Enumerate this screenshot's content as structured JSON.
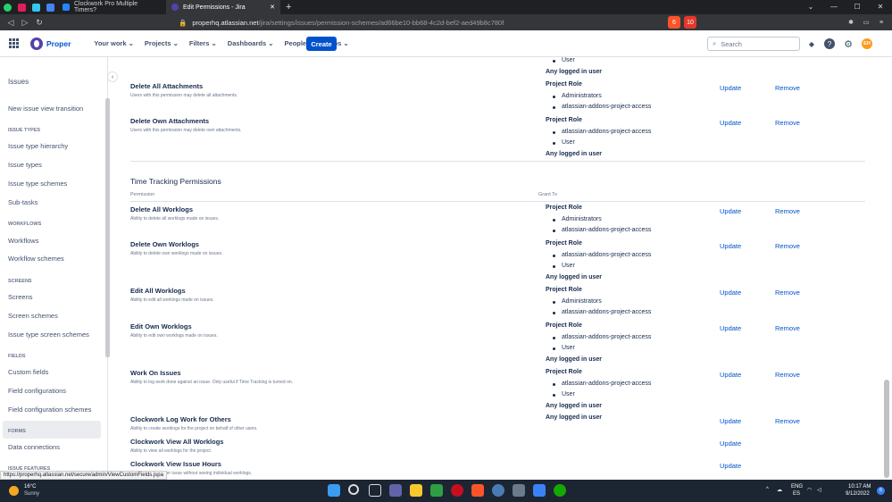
{
  "browser": {
    "tabs": [
      {
        "title": "Clockwork Pro Multiple Timers?",
        "active": false
      },
      {
        "title": "Edit Permissions - Jira",
        "active": true
      }
    ],
    "url_host": "properhq.atlassian.net",
    "url_path": "/jira/settings/issues/permission-schemes/ad66be10-bb68-4c2d-bef2-aed49b8c780f",
    "extension_badge_1": "6",
    "extension_badge_2": "10",
    "status_url": "https://properhq.atlassian.net/secure/admin/ViewCustomFields.jspa"
  },
  "topnav": {
    "logo": "Proper",
    "menus": [
      "Your work",
      "Projects",
      "Filters",
      "Dashboards",
      "People",
      "Apps"
    ],
    "create_label": "Create",
    "search_placeholder": "Search",
    "avatar_initials": "EH"
  },
  "sidebar": {
    "title": "Issues",
    "items": [
      {
        "type": "item",
        "label": "New issue view transition"
      },
      {
        "type": "head",
        "label": "ISSUE TYPES"
      },
      {
        "type": "item",
        "label": "Issue type hierarchy"
      },
      {
        "type": "item",
        "label": "Issue types"
      },
      {
        "type": "item",
        "label": "Issue type schemes"
      },
      {
        "type": "item",
        "label": "Sub-tasks"
      },
      {
        "type": "head",
        "label": "WORKFLOWS"
      },
      {
        "type": "item",
        "label": "Workflows"
      },
      {
        "type": "item",
        "label": "Workflow schemes"
      },
      {
        "type": "head",
        "label": "SCREENS"
      },
      {
        "type": "item",
        "label": "Screens"
      },
      {
        "type": "item",
        "label": "Screen schemes"
      },
      {
        "type": "item",
        "label": "Issue type screen schemes"
      },
      {
        "type": "head",
        "label": "FIELDS"
      },
      {
        "type": "item",
        "label": "Custom fields",
        "selected": true
      },
      {
        "type": "item",
        "label": "Field configurations"
      },
      {
        "type": "item",
        "label": "Field configuration schemes"
      },
      {
        "type": "head",
        "label": "FORMS"
      },
      {
        "type": "item",
        "label": "Data connections"
      },
      {
        "type": "head",
        "label": "ISSUE FEATURES"
      }
    ]
  },
  "main": {
    "top_residual": {
      "bullet": "User",
      "any": "Any logged in user"
    },
    "attachments": [
      {
        "name": "Delete All Attachments",
        "desc": "Users with this permission may delete all attachments.",
        "role": "Project Role",
        "bullets": [
          "Administrators",
          "atlassian-addons-project-access"
        ],
        "any": "",
        "actions": [
          "Update",
          "Remove"
        ]
      },
      {
        "name": "Delete Own Attachments",
        "desc": "Users with this permission may delete own attachments.",
        "role": "Project Role",
        "bullets": [
          "atlassian-addons-project-access",
          "User"
        ],
        "any": "Any logged in user",
        "actions": [
          "Update",
          "Remove"
        ]
      }
    ],
    "section_title": "Time Tracking Permissions",
    "col_permission": "Permission",
    "col_grant": "Grant To",
    "time_tracking": [
      {
        "name": "Delete All Worklogs",
        "desc": "Ability to delete all worklogs made on issues.",
        "role": "Project Role",
        "bullets": [
          "Administrators",
          "atlassian-addons-project-access"
        ],
        "any": "",
        "actions": [
          "Update",
          "Remove"
        ]
      },
      {
        "name": "Delete Own Worklogs",
        "desc": "Ability to delete own worklogs made on issues.",
        "role": "Project Role",
        "bullets": [
          "atlassian-addons-project-access",
          "User"
        ],
        "any": "Any logged in user",
        "actions": [
          "Update",
          "Remove"
        ]
      },
      {
        "name": "Edit All Worklogs",
        "desc": "Ability to edit all worklogs made on issues.",
        "role": "Project Role",
        "bullets": [
          "Administrators",
          "atlassian-addons-project-access"
        ],
        "any": "",
        "actions": [
          "Update",
          "Remove"
        ]
      },
      {
        "name": "Edit Own Worklogs",
        "desc": "Ability to edit own worklogs made on issues.",
        "role": "Project Role",
        "bullets": [
          "atlassian-addons-project-access",
          "User"
        ],
        "any": "Any logged in user",
        "actions": [
          "Update",
          "Remove"
        ]
      },
      {
        "name": "Work On Issues",
        "desc": "Ability to log work done against an issue. Only useful if Time Tracking is turned on.",
        "role": "Project Role",
        "bullets": [
          "atlassian-addons-project-access",
          "User"
        ],
        "any": "Any logged in user",
        "actions": [
          "Update",
          "Remove"
        ]
      },
      {
        "name": "Clockwork Log Work for Others",
        "desc": "Ability to create worklogs for the project on behalf of other users.",
        "role": "",
        "bullets": [],
        "any": "Any logged in user",
        "actions": [
          "Update",
          "Remove"
        ]
      },
      {
        "name": "Clockwork View All Worklogs",
        "desc": "Ability to view all worklogs for the project.",
        "role": "",
        "bullets": [],
        "any": "",
        "actions": [
          "Update"
        ]
      },
      {
        "name": "Clockwork View Issue Hours",
        "desc": "number of hours per issue without seeing individual worklogs.",
        "role": "",
        "bullets": [],
        "any": "",
        "actions": [
          "Update"
        ]
      }
    ]
  },
  "taskbar": {
    "weather_temp": "16°C",
    "weather_desc": "Sunny",
    "lang_1": "ENG",
    "lang_2": "ES",
    "time": "10:17 AM",
    "date": "9/12/2022",
    "notif_count": "6"
  }
}
